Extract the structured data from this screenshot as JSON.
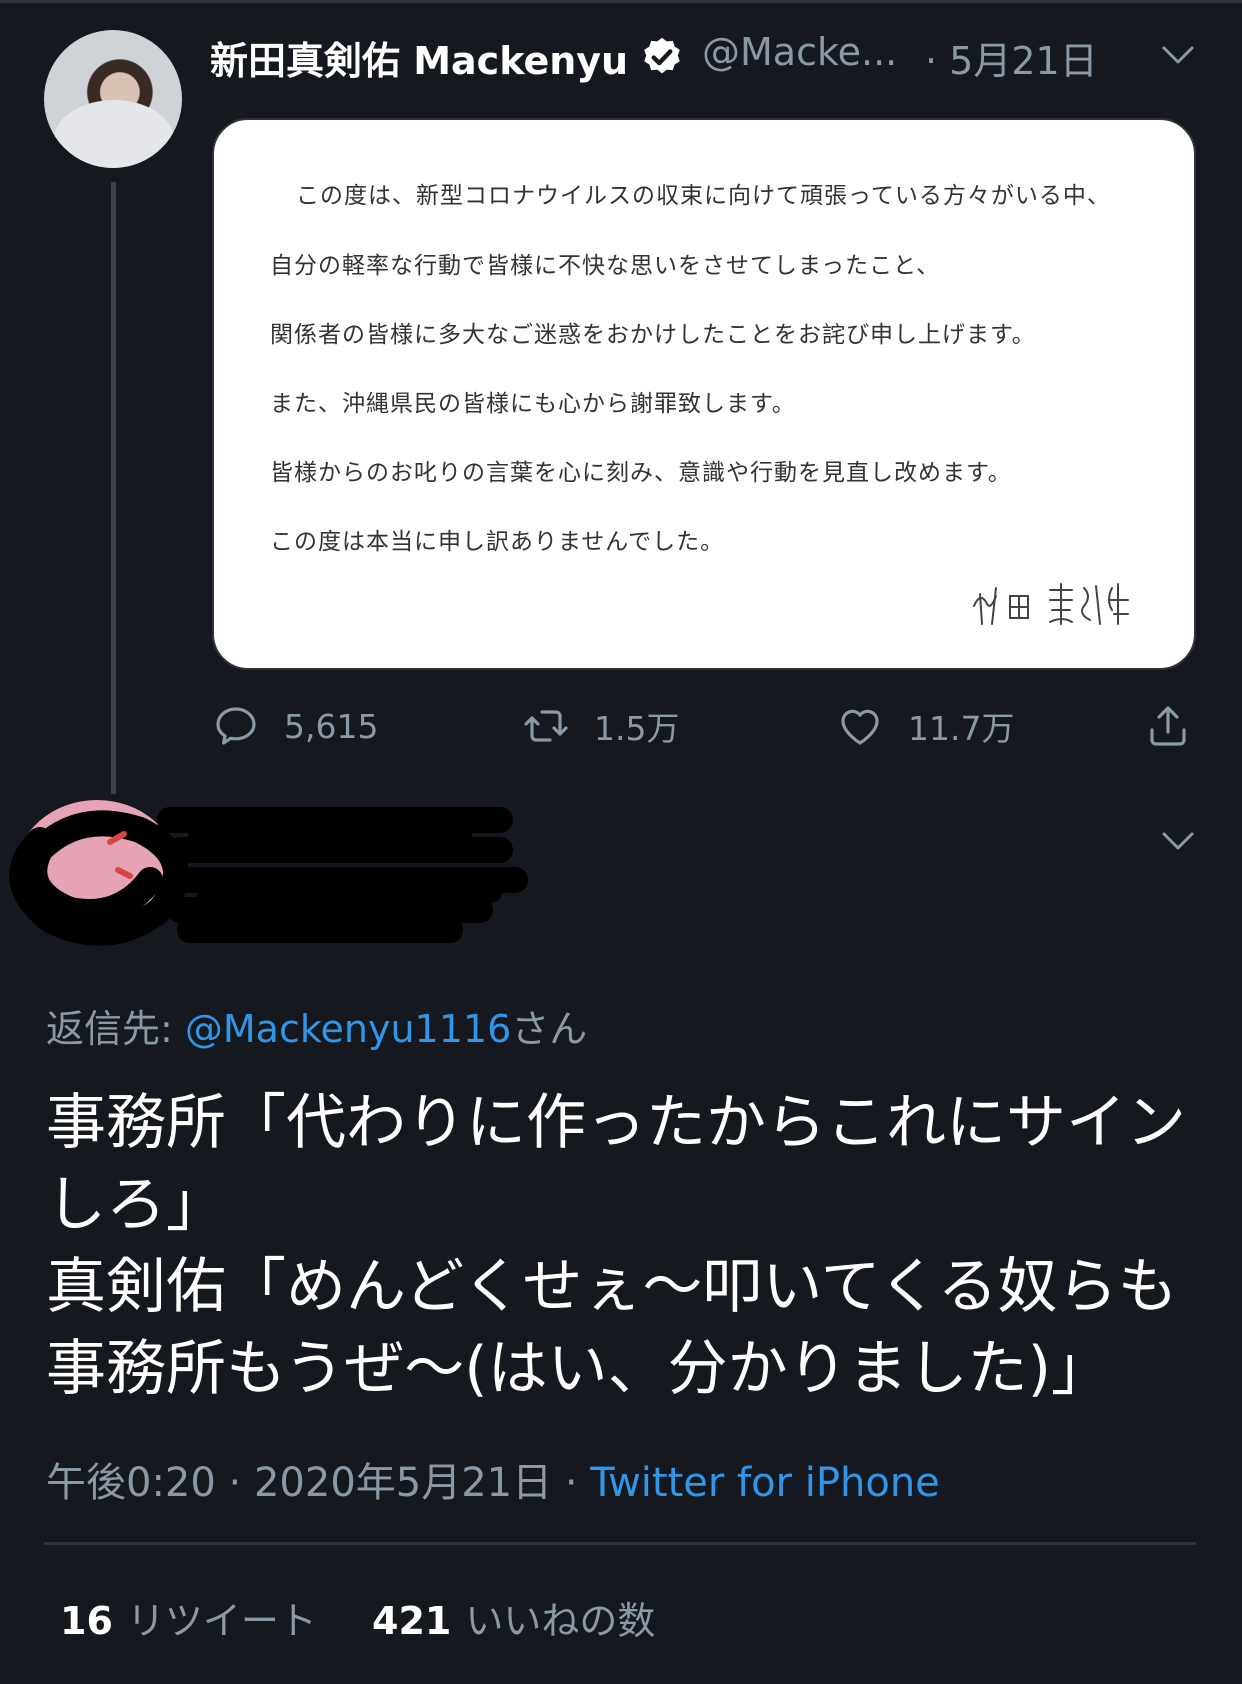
{
  "tweet": {
    "author_name": "新田真剣佑 Mackenyu",
    "handle": "@Macke...",
    "date": "· 5月21日",
    "statement_lines": [
      "この度は、新型コロナウイルスの収束に向けて頑張っている方々がいる中、",
      "自分の軽率な行動で皆様に不快な思いをさせてしまったこと、",
      "関係者の皆様に多大なご迷惑をおかけしたことをお詫び申し上げます。",
      "また、沖縄県民の皆様にも心から謝罪致します。",
      "皆様からのお叱りの言葉を心に刻み、意識や行動を見直し改めます。",
      "この度は本当に申し訳ありませんでした。"
    ],
    "signature": "新田 真剣佑",
    "replies": "5,615",
    "retweets": "1.5万",
    "likes": "11.7万"
  },
  "reply": {
    "reply_to_label": "返信先: ",
    "reply_to_handle": "@Mackenyu1116",
    "reply_to_suffix": "さん",
    "text_lines": [
      "事務所「代わりに作ったからこれにサイン",
      "しろ」",
      "真剣佑「めんどくせぇ〜叩いてくる奴らも",
      "事務所もうぜ〜(はい、分かりました)」"
    ],
    "timestamp": "午後0:20 · 2020年5月21日 · ",
    "source": "Twitter for iPhone",
    "retweet_count": "16",
    "retweet_label": "リツイート",
    "like_count": "421",
    "like_label": "いいねの数"
  },
  "colors": {
    "background": "#15181f",
    "secondary_text": "#8b98a5",
    "link": "#2f97e6"
  },
  "icons": [
    "verified-badge-icon",
    "chevron-down-icon",
    "reply-icon",
    "retweet-icon",
    "like-icon",
    "share-icon"
  ]
}
